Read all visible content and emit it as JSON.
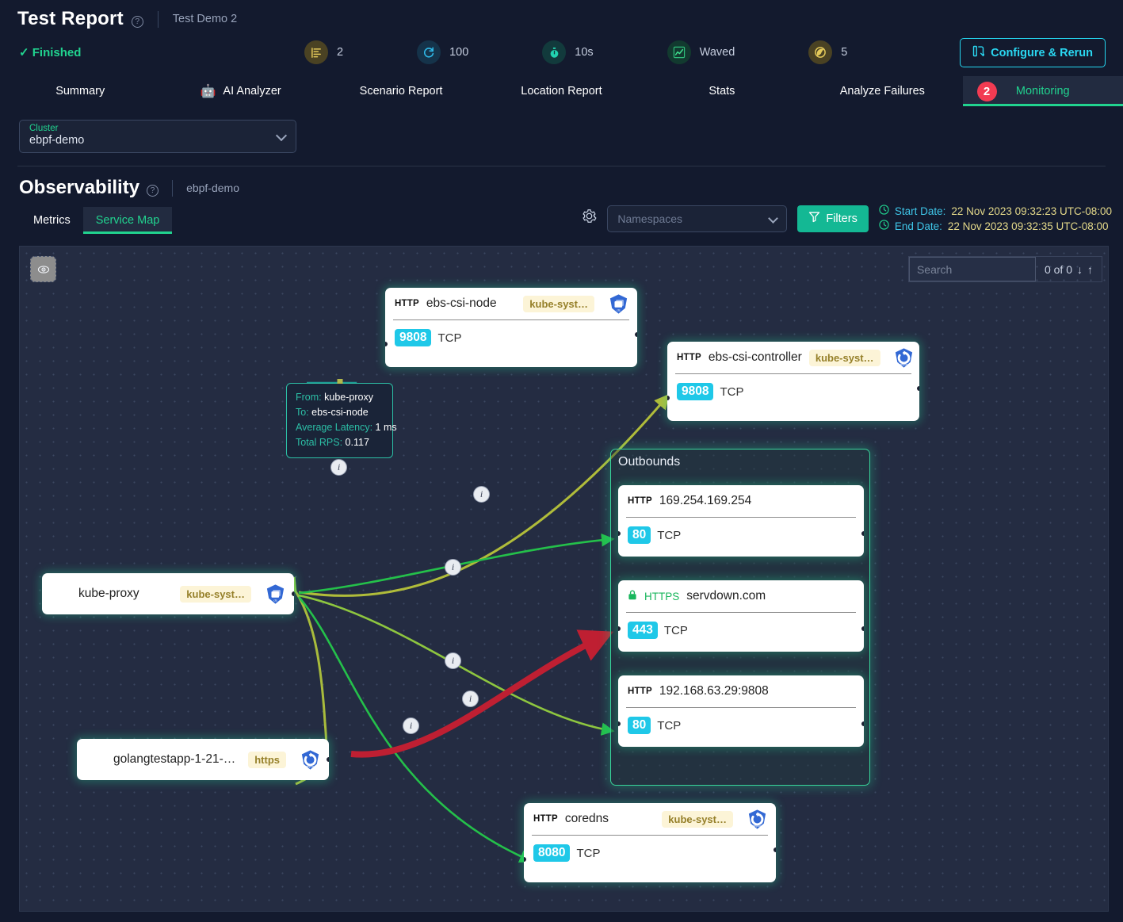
{
  "header": {
    "title": "Test Report",
    "help_icon": "question-circle-icon",
    "subtitle": "Test Demo 2",
    "status": "✓ Finished",
    "rerun_button": "Configure & Rerun",
    "rerun_icon": "report-rerun-icon",
    "stats": [
      {
        "icon": "scenario-steps-icon",
        "value": "2",
        "color": "#4a4223"
      },
      {
        "icon": "iterations-icon",
        "value": "100",
        "color": "#15334a"
      },
      {
        "icon": "duration-icon",
        "value": "10s",
        "color": "#123a3c"
      },
      {
        "icon": "load-profile-icon",
        "value": "Waved",
        "color": "#123a2f"
      },
      {
        "icon": "regions-icon",
        "value": "5",
        "color": "#4a4223"
      }
    ]
  },
  "tabs": [
    {
      "label": "Summary",
      "active": false,
      "icon": ""
    },
    {
      "label": "AI Analyzer",
      "active": false,
      "icon": "robot-icon"
    },
    {
      "label": "Scenario Report",
      "active": false,
      "icon": ""
    },
    {
      "label": "Location Report",
      "active": false,
      "icon": ""
    },
    {
      "label": "Stats",
      "active": false,
      "icon": ""
    },
    {
      "label": "Analyze Failures",
      "active": false,
      "icon": ""
    },
    {
      "label": "Monitoring",
      "active": true,
      "icon": "",
      "badge": "2"
    }
  ],
  "cluster": {
    "label": "Cluster",
    "value": "ebpf-demo",
    "chevron_icon": "chevron-down-icon"
  },
  "observability": {
    "title": "Observability",
    "help_icon": "question-circle-icon",
    "subtitle": "ebpf-demo",
    "sub_tabs": [
      {
        "label": "Metrics",
        "active": false
      },
      {
        "label": "Service Map",
        "active": true
      }
    ]
  },
  "toolbar": {
    "settings_icon": "gear-icon",
    "namespaces_placeholder": "Namespaces",
    "namespaces_value": "",
    "filters_label": "Filters",
    "filters_icon": "funnel-icon",
    "start_date_label": "Start Date:",
    "start_date_value": "22 Nov 2023 09:32:23 UTC-08:00",
    "end_date_label": "End Date:",
    "end_date_value": "22 Nov 2023 09:32:35 UTC-08:00",
    "clock_icon": "clock-icon"
  },
  "canvas": {
    "visibility_icon": "eye-icon",
    "search_placeholder": "Search",
    "search_value": "",
    "search_count": "0 of 0",
    "prev_icon": "arrow-down-icon",
    "next_icon": "arrow-up-icon"
  },
  "graph": {
    "nodes": [
      {
        "id": "ebs-csi-node",
        "protocol": "HTTP",
        "name": "ebs-csi-node",
        "namespace": "kube-syst…",
        "kind_icon": "k8s-daemonset-icon",
        "port": "9808",
        "transport": "TCP"
      },
      {
        "id": "ebs-csi-controller",
        "protocol": "HTTP",
        "name": "ebs-csi-controller",
        "namespace": "kube-syst…",
        "kind_icon": "k8s-deployment-icon",
        "port": "9808",
        "transport": "TCP"
      },
      {
        "id": "kube-proxy",
        "protocol": "",
        "name": "kube-proxy",
        "namespace": "kube-syst…",
        "kind_icon": "k8s-daemonset-icon",
        "port": "",
        "transport": ""
      },
      {
        "id": "golangtestapp",
        "protocol": "",
        "name": "golangtestapp-1-21-…",
        "namespace": "https",
        "kind_icon": "k8s-deployment-icon",
        "port": "",
        "transport": ""
      },
      {
        "id": "coredns",
        "protocol": "HTTP",
        "name": "coredns",
        "namespace": "kube-syst…",
        "kind_icon": "k8s-deployment-icon",
        "port": "8080",
        "transport": "TCP"
      }
    ],
    "outbounds": {
      "title": "Outbounds",
      "nodes": [
        {
          "id": "ob-169",
          "protocol": "HTTP",
          "secure": false,
          "name": "169.254.169.254",
          "port": "80",
          "transport": "TCP"
        },
        {
          "id": "ob-servdown",
          "protocol": "HTTPS",
          "secure": true,
          "lock_icon": "lock-icon",
          "name": "servdown.com",
          "port": "443",
          "transport": "TCP"
        },
        {
          "id": "ob-192",
          "protocol": "HTTP",
          "secure": false,
          "name": "192.168.63.29:9808",
          "port": "80",
          "transport": "TCP"
        }
      ]
    },
    "tooltip": {
      "from_label": "From:",
      "from_value": "kube-proxy",
      "to_label": "To:",
      "to_value": "ebs-csi-node",
      "latency_label": "Average Latency:",
      "latency_value": "1 ms",
      "rps_label": "Total RPS:",
      "rps_value": "0.117"
    },
    "edge_marker_icon": "info-icon",
    "edge_colors": {
      "olive": "#b0bc3a",
      "lime": "#8ec63f",
      "green": "#24c04a",
      "red": "#bf1f32",
      "teal": "#1e9e96"
    }
  }
}
